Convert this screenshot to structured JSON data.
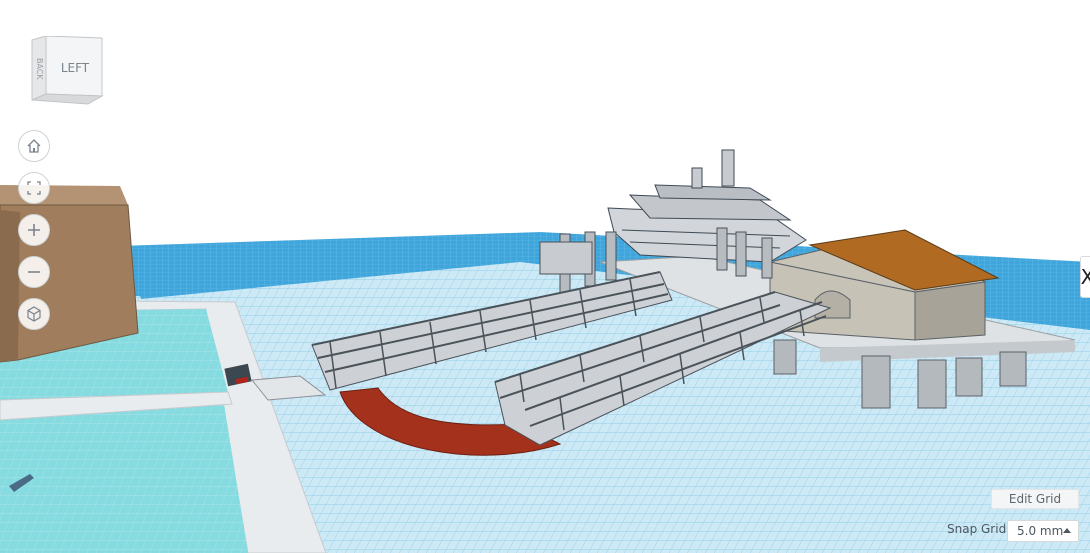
{
  "viewcube": {
    "faces": [
      "LEFT",
      "BACK"
    ]
  },
  "nav_icons": [
    "home-icon",
    "fit-view-icon",
    "zoom-in-icon",
    "zoom-out-icon",
    "perspective-icon"
  ],
  "grid_panel": {
    "edit_grid_label": "Edit Grid",
    "snap_grid_label": "Snap Grid",
    "snap_grid_value": "5.0 mm"
  },
  "side_tab": {
    "label": "X"
  },
  "colors": {
    "grid_blue": "#2b9ad4",
    "grid_line": "#8fcbe8",
    "water_cyan": "#7fd6dd",
    "shape_gray": "#b9bdc2",
    "ramp_red": "#a3311c",
    "roof_orange": "#b06a22",
    "cliff_brown": "#9a7b5c"
  }
}
